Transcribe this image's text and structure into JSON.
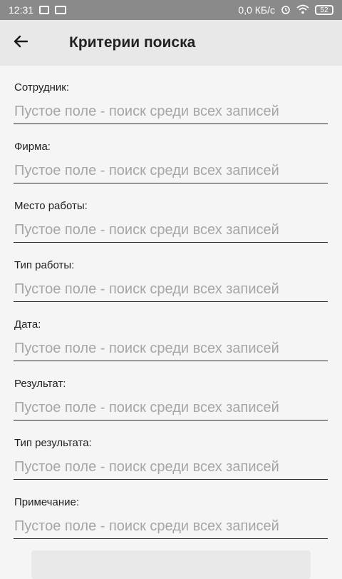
{
  "status_bar": {
    "time": "12:31",
    "network_speed": "0,0 КБ/с",
    "battery_level": "52",
    "icons": [
      "square-notification-icon",
      "message-icon",
      "alarm-icon",
      "wifi-icon",
      "battery-icon"
    ]
  },
  "app_bar": {
    "title": "Критерии поиска",
    "back_icon": "arrow-left-icon"
  },
  "fields": [
    {
      "label": "Сотрудник:",
      "value": "",
      "placeholder": "Пустое поле - поиск среди всех записей"
    },
    {
      "label": "Фирма:",
      "value": "",
      "placeholder": "Пустое поле - поиск среди всех записей"
    },
    {
      "label": "Место работы:",
      "value": "",
      "placeholder": "Пустое поле - поиск среди всех записей"
    },
    {
      "label": "Тип работы:",
      "value": "",
      "placeholder": "Пустое поле - поиск среди всех записей"
    },
    {
      "label": "Дата:",
      "value": "",
      "placeholder": "Пустое поле - поиск среди всех записей"
    },
    {
      "label": "Результат:",
      "value": "",
      "placeholder": "Пустое поле - поиск среди всех записей"
    },
    {
      "label": "Тип результата:",
      "value": "",
      "placeholder": "Пустое поле - поиск среди всех записей"
    },
    {
      "label": "Примечание:",
      "value": "",
      "placeholder": "Пустое поле - поиск среди всех записей"
    }
  ]
}
